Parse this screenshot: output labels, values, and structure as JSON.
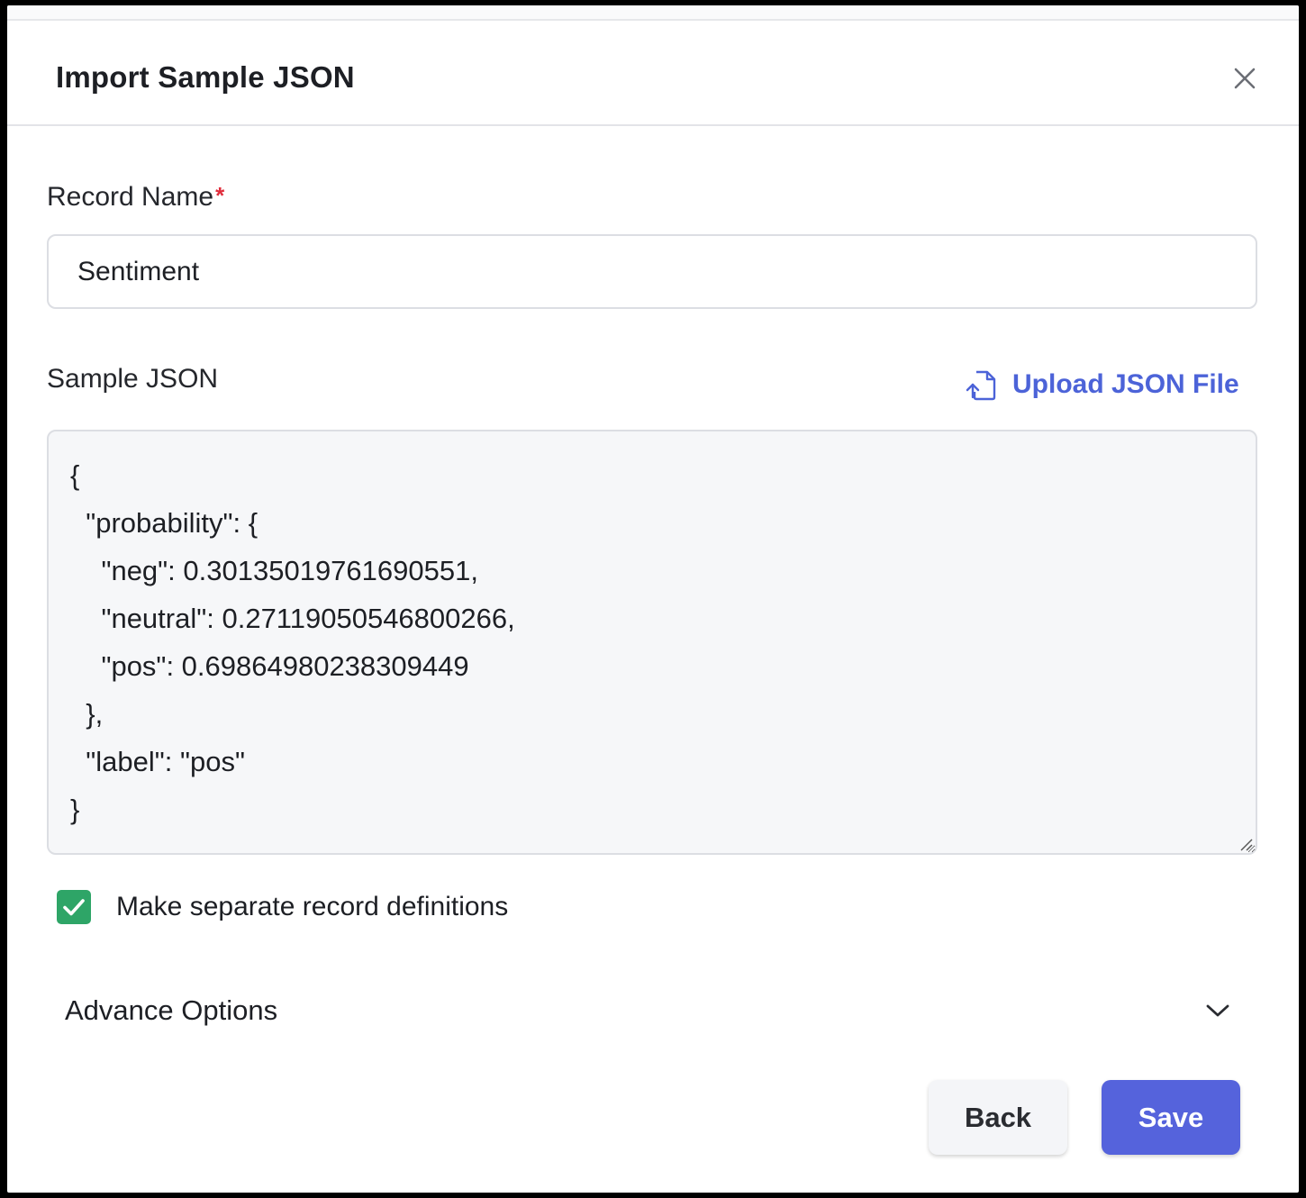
{
  "dialog": {
    "title": "Import Sample JSON"
  },
  "record_name": {
    "label": "Record Name",
    "required_mark": "*",
    "value": "Sentiment"
  },
  "sample_json": {
    "label": "Sample JSON",
    "upload_label": "Upload JSON File",
    "content": "{\n  \"probability\": {\n    \"neg\": 0.30135019761690551,\n    \"neutral\": 0.27119050546800266,\n    \"pos\": 0.69864980238309449\n  },\n  \"label\": \"pos\"\n}"
  },
  "separate_definitions": {
    "label": "Make separate record definitions",
    "checked": true
  },
  "advance_options": {
    "label": "Advance Options"
  },
  "footer": {
    "back_label": "Back",
    "save_label": "Save"
  },
  "colors": {
    "accent": "#4c63d8",
    "save_button": "#5563dc",
    "checkbox": "#2ea567",
    "required": "#e02d3c"
  },
  "icons": {
    "close": "close-icon",
    "upload": "file-upload-icon",
    "check": "check-icon",
    "chevron": "chevron-down-icon"
  }
}
